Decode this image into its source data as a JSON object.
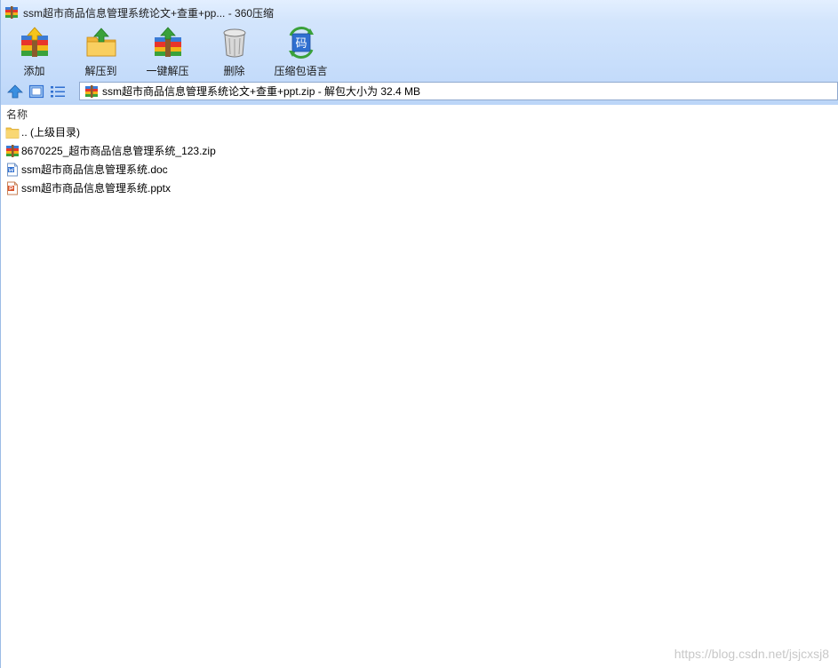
{
  "window": {
    "title": "ssm超市商品信息管理系统论文+查重+pp... - 360压缩"
  },
  "toolbar": {
    "items": [
      {
        "label": "添加",
        "icon": "add-archive-icon"
      },
      {
        "label": "解压到",
        "icon": "extract-to-folder-icon"
      },
      {
        "label": "一键解压",
        "icon": "one-click-extract-icon"
      },
      {
        "label": "删除",
        "icon": "trash-can-icon"
      },
      {
        "label": "压缩包语言",
        "icon": "archive-language-icon"
      }
    ],
    "language_glyph": "码"
  },
  "address": {
    "path": "ssm超市商品信息管理系统论文+查重+ppt.zip - 解包大小为 32.4 MB"
  },
  "list": {
    "column_name": "名称",
    "rows": [
      {
        "name": ".. (上级目录)",
        "type": "folder"
      },
      {
        "name": "8670225_超市商品信息管理系统_123.zip",
        "type": "zip"
      },
      {
        "name": "ssm超市商品信息管理系统.doc",
        "type": "doc"
      },
      {
        "name": "ssm超市商品信息管理系统.pptx",
        "type": "pptx"
      }
    ]
  },
  "watermark": "https://blog.csdn.net/jsjcxsj8"
}
